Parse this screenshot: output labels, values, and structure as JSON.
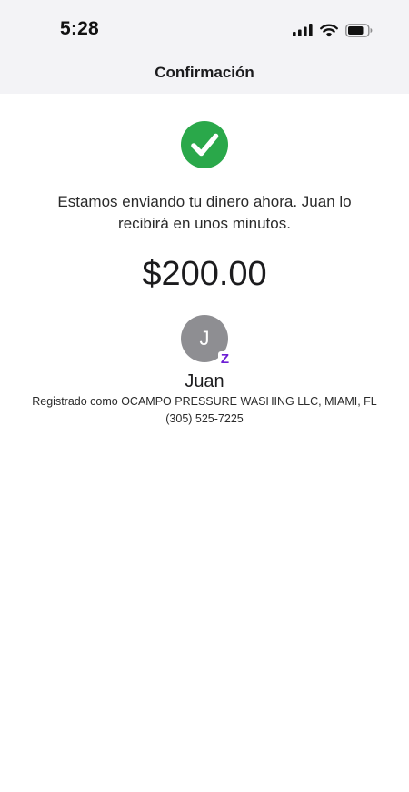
{
  "status_bar": {
    "time": "5:28",
    "icons": [
      "cellular-signal-icon",
      "wifi-icon",
      "battery-icon"
    ]
  },
  "header": {
    "title": "Confirmación"
  },
  "confirmation": {
    "status_icon": "check-circle-icon",
    "message": "Estamos enviando tu dinero ahora. Juan  lo recibirá en unos minutos.",
    "amount": "$200.00"
  },
  "recipient": {
    "initial": "J",
    "badge": "Z",
    "name": "Juan",
    "registered_as": "Registrado como OCAMPO PRESSURE WASHING LLC, MIAMI, FL",
    "phone": "(305) 525-7225"
  },
  "colors": {
    "success_green": "#2aa84a",
    "avatar_gray": "#8e8e92",
    "brand_purple": "#6d1ed4",
    "header_bg": "#f3f3f6"
  }
}
